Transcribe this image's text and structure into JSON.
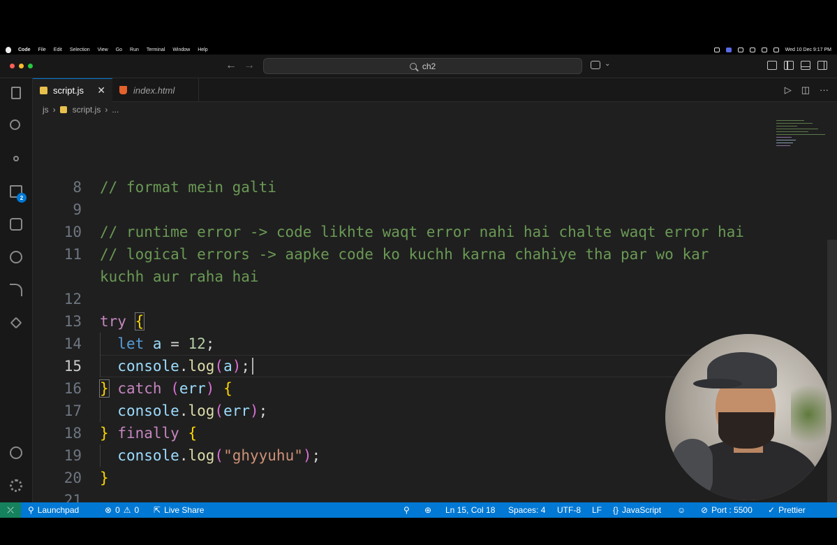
{
  "menubar": {
    "app": "Code",
    "items": [
      "File",
      "Edit",
      "Selection",
      "View",
      "Go",
      "Run",
      "Terminal",
      "Window",
      "Help"
    ],
    "clock": "Wed 10 Dec 9:17 PM"
  },
  "titlebar": {
    "search": "ch2"
  },
  "tabs": [
    {
      "label": "script.js",
      "active": true
    },
    {
      "label": "index.html",
      "active": false
    }
  ],
  "breadcrumb": {
    "folder": "js",
    "file": "script.js",
    "more": "..."
  },
  "activity": {
    "extensions_badge": "2"
  },
  "editor": {
    "lines": [
      {
        "n": "8",
        "text": "// format mein galti"
      },
      {
        "n": "9",
        "text": ""
      },
      {
        "n": "10",
        "text": "// runtime error -> code likhte waqt error nahi hai chalte waqt error hai"
      },
      {
        "n": "11",
        "text": "// logical errors -> aapke code ko kuchh karna chahiye tha par wo kar"
      },
      {
        "n": "",
        "text": "kuchh aur raha hai"
      },
      {
        "n": "12",
        "text": ""
      },
      {
        "n": "13",
        "text": "try {"
      },
      {
        "n": "14",
        "text": "  let a = 12;"
      },
      {
        "n": "15",
        "text": "  console.log(a);"
      },
      {
        "n": "16",
        "text": "} catch (err) {"
      },
      {
        "n": "17",
        "text": "  console.log(err);"
      },
      {
        "n": "18",
        "text": "} finally {"
      },
      {
        "n": "19",
        "text": "  console.log(\"ghyyuhu\");"
      },
      {
        "n": "20",
        "text": "}"
      },
      {
        "n": "21",
        "text": ""
      }
    ]
  },
  "statusbar": {
    "launchpad": "Launchpad",
    "errors": "0",
    "warnings": "0",
    "liveshare": "Live Share",
    "position": "Ln 15, Col 18",
    "spaces": "Spaces: 4",
    "encoding": "UTF-8",
    "eol": "LF",
    "language": "JavaScript",
    "port": "Port : 5500",
    "formatter": "Prettier"
  },
  "colors": {
    "statusbar": "#0078d4",
    "comment": "#6a9955",
    "keyword": "#c586c0",
    "string": "#ce9178"
  }
}
